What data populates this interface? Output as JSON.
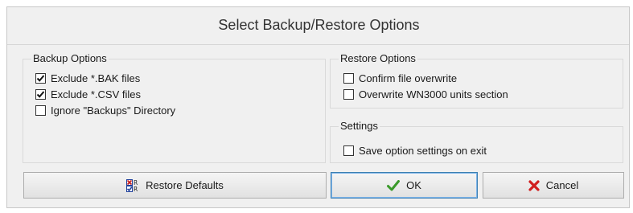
{
  "dialog": {
    "title": "Select Backup/Restore Options"
  },
  "backup": {
    "label": "Backup Options",
    "items": [
      {
        "label": "Exclude *.BAK files",
        "checked": true
      },
      {
        "label": "Exclude *.CSV files",
        "checked": true
      },
      {
        "label": "Ignore \"Backups\" Directory",
        "checked": false
      }
    ]
  },
  "restore": {
    "label": "Restore Options",
    "items": [
      {
        "label": "Confirm file overwrite",
        "checked": false
      },
      {
        "label": "Overwrite WN3000 units section",
        "checked": false
      }
    ]
  },
  "settings": {
    "label": "Settings",
    "items": [
      {
        "label": "Save option settings on exit",
        "checked": false
      }
    ]
  },
  "buttons": {
    "restore_defaults": "Restore Defaults",
    "ok": "OK",
    "cancel": "Cancel"
  },
  "icons": {
    "restore_defaults": "checklist-icon",
    "ok": "green-checkmark-icon",
    "cancel": "red-x-icon"
  },
  "colors": {
    "ok_check": "#3a9a2a",
    "cancel_x": "#d11f1f",
    "primary_border": "#3c7fb1"
  }
}
